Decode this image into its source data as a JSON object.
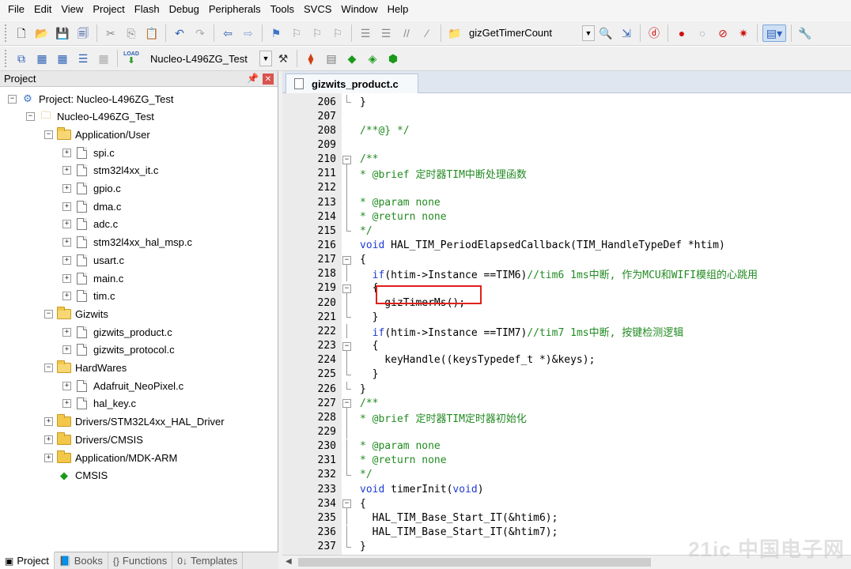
{
  "menu": [
    "File",
    "Edit",
    "View",
    "Project",
    "Flash",
    "Debug",
    "Peripherals",
    "Tools",
    "SVCS",
    "Window",
    "Help"
  ],
  "toolbar1": {
    "function_combo": "gizGetTimerCount"
  },
  "toolbar2": {
    "load_label": "LOAD",
    "target_combo": "Nucleo-L496ZG_Test"
  },
  "project_panel": {
    "title": "Project",
    "tree": [
      {
        "label": "Project: Nucleo-L496ZG_Test",
        "depth": 0,
        "kind": "project",
        "expander": "−"
      },
      {
        "label": "Nucleo-L496ZG_Test",
        "depth": 1,
        "kind": "target",
        "expander": "−"
      },
      {
        "label": "Application/User",
        "depth": 2,
        "kind": "folder-open",
        "expander": "−"
      },
      {
        "label": "spi.c",
        "depth": 3,
        "kind": "file",
        "expander": "+"
      },
      {
        "label": "stm32l4xx_it.c",
        "depth": 3,
        "kind": "file",
        "expander": "+"
      },
      {
        "label": "gpio.c",
        "depth": 3,
        "kind": "file",
        "expander": "+"
      },
      {
        "label": "dma.c",
        "depth": 3,
        "kind": "file",
        "expander": "+"
      },
      {
        "label": "adc.c",
        "depth": 3,
        "kind": "file",
        "expander": "+"
      },
      {
        "label": "stm32l4xx_hal_msp.c",
        "depth": 3,
        "kind": "file",
        "expander": "+"
      },
      {
        "label": "usart.c",
        "depth": 3,
        "kind": "file",
        "expander": "+"
      },
      {
        "label": "main.c",
        "depth": 3,
        "kind": "file",
        "expander": "+"
      },
      {
        "label": "tim.c",
        "depth": 3,
        "kind": "file",
        "expander": "+"
      },
      {
        "label": "Gizwits",
        "depth": 2,
        "kind": "folder-open",
        "expander": "−"
      },
      {
        "label": "gizwits_product.c",
        "depth": 3,
        "kind": "file",
        "expander": "+"
      },
      {
        "label": "gizwits_protocol.c",
        "depth": 3,
        "kind": "file",
        "expander": "+"
      },
      {
        "label": "HardWares",
        "depth": 2,
        "kind": "folder-open",
        "expander": "−"
      },
      {
        "label": "Adafruit_NeoPixel.c",
        "depth": 3,
        "kind": "file",
        "expander": "+"
      },
      {
        "label": "hal_key.c",
        "depth": 3,
        "kind": "file",
        "expander": "+"
      },
      {
        "label": "Drivers/STM32L4xx_HAL_Driver",
        "depth": 2,
        "kind": "folder",
        "expander": "+"
      },
      {
        "label": "Drivers/CMSIS",
        "depth": 2,
        "kind": "folder",
        "expander": "+"
      },
      {
        "label": "Application/MDK-ARM",
        "depth": 2,
        "kind": "folder",
        "expander": "+"
      },
      {
        "label": "CMSIS",
        "depth": 2,
        "kind": "component",
        "expander": ""
      }
    ],
    "tabs": [
      {
        "label": "Project",
        "icon": "▣"
      },
      {
        "label": "Books",
        "icon": "📘"
      },
      {
        "label": "Functions",
        "icon": "{}"
      },
      {
        "label": "Templates",
        "icon": "0↓"
      }
    ]
  },
  "editor": {
    "tab_label": "gizwits_product.c",
    "lines": [
      {
        "n": "206",
        "fold": "end",
        "segs": [
          [
            "d",
            "}"
          ]
        ]
      },
      {
        "n": "207",
        "fold": "",
        "segs": []
      },
      {
        "n": "208",
        "fold": "",
        "segs": [
          [
            "c",
            "/**@} */"
          ]
        ]
      },
      {
        "n": "209",
        "fold": "",
        "segs": []
      },
      {
        "n": "210",
        "fold": "open",
        "segs": [
          [
            "c",
            "/**"
          ]
        ]
      },
      {
        "n": "211",
        "fold": "line",
        "segs": [
          [
            "c",
            "* @brief 定时器TIM中断处理函数"
          ]
        ]
      },
      {
        "n": "212",
        "fold": "line",
        "segs": []
      },
      {
        "n": "213",
        "fold": "line",
        "segs": [
          [
            "c",
            "* @param none"
          ]
        ]
      },
      {
        "n": "214",
        "fold": "line",
        "segs": [
          [
            "c",
            "* @return none"
          ]
        ]
      },
      {
        "n": "215",
        "fold": "end",
        "segs": [
          [
            "c",
            "*/"
          ]
        ]
      },
      {
        "n": "216",
        "fold": "",
        "segs": [
          [
            "k",
            "void"
          ],
          [
            "d",
            " HAL_TIM_PeriodElapsedCallback(TIM_HandleTypeDef *htim)"
          ]
        ]
      },
      {
        "n": "217",
        "fold": "open",
        "segs": [
          [
            "d",
            "{"
          ]
        ]
      },
      {
        "n": "218",
        "fold": "line",
        "segs": [
          [
            "d",
            "  "
          ],
          [
            "k",
            "if"
          ],
          [
            "d",
            "(htim->Instance ==TIM6)"
          ],
          [
            "c",
            "//tim6 1ms中断, 作为MCU和WIFI模组的心跳用"
          ]
        ]
      },
      {
        "n": "219",
        "fold": "open",
        "segs": [
          [
            "d",
            "  {"
          ]
        ]
      },
      {
        "n": "220",
        "fold": "line",
        "segs": [
          [
            "d",
            "    gizTimerMs();"
          ]
        ]
      },
      {
        "n": "221",
        "fold": "end",
        "segs": [
          [
            "d",
            "  }"
          ]
        ]
      },
      {
        "n": "222",
        "fold": "line",
        "segs": [
          [
            "d",
            "  "
          ],
          [
            "k",
            "if"
          ],
          [
            "d",
            "(htim->Instance ==TIM7)"
          ],
          [
            "c",
            "//tim7 1ms中断, 按键检测逻辑"
          ]
        ]
      },
      {
        "n": "223",
        "fold": "open",
        "segs": [
          [
            "d",
            "  {"
          ]
        ]
      },
      {
        "n": "224",
        "fold": "line",
        "segs": [
          [
            "d",
            "    keyHandle((keysTypedef_t *)&keys);"
          ]
        ]
      },
      {
        "n": "225",
        "fold": "end",
        "segs": [
          [
            "d",
            "  }"
          ]
        ]
      },
      {
        "n": "226",
        "fold": "end",
        "segs": [
          [
            "d",
            "}"
          ]
        ]
      },
      {
        "n": "227",
        "fold": "open",
        "segs": [
          [
            "c",
            "/**"
          ]
        ]
      },
      {
        "n": "228",
        "fold": "line",
        "segs": [
          [
            "c",
            "* @brief 定时器TIM定时器初始化"
          ]
        ]
      },
      {
        "n": "229",
        "fold": "line",
        "segs": []
      },
      {
        "n": "230",
        "fold": "line",
        "segs": [
          [
            "c",
            "* @param none"
          ]
        ]
      },
      {
        "n": "231",
        "fold": "line",
        "segs": [
          [
            "c",
            "* @return none"
          ]
        ]
      },
      {
        "n": "232",
        "fold": "end",
        "segs": [
          [
            "c",
            "*/"
          ]
        ]
      },
      {
        "n": "233",
        "fold": "",
        "segs": [
          [
            "k",
            "void"
          ],
          [
            "d",
            " timerInit("
          ],
          [
            "k",
            "void"
          ],
          [
            "d",
            ")"
          ]
        ]
      },
      {
        "n": "234",
        "fold": "open",
        "segs": [
          [
            "d",
            "{"
          ]
        ]
      },
      {
        "n": "235",
        "fold": "line",
        "segs": [
          [
            "d",
            "  HAL_TIM_Base_Start_IT(&htim6);"
          ]
        ]
      },
      {
        "n": "236",
        "fold": "line",
        "segs": [
          [
            "d",
            "  HAL_TIM_Base_Start_IT(&htim7);"
          ]
        ]
      },
      {
        "n": "237",
        "fold": "end",
        "segs": [
          [
            "d",
            "}"
          ]
        ]
      }
    ]
  },
  "watermark": "21ic 中国电子网",
  "colors": {
    "comment": "#228b22",
    "keyword": "#1f3bd1",
    "highlight_box": "#e0201b"
  }
}
